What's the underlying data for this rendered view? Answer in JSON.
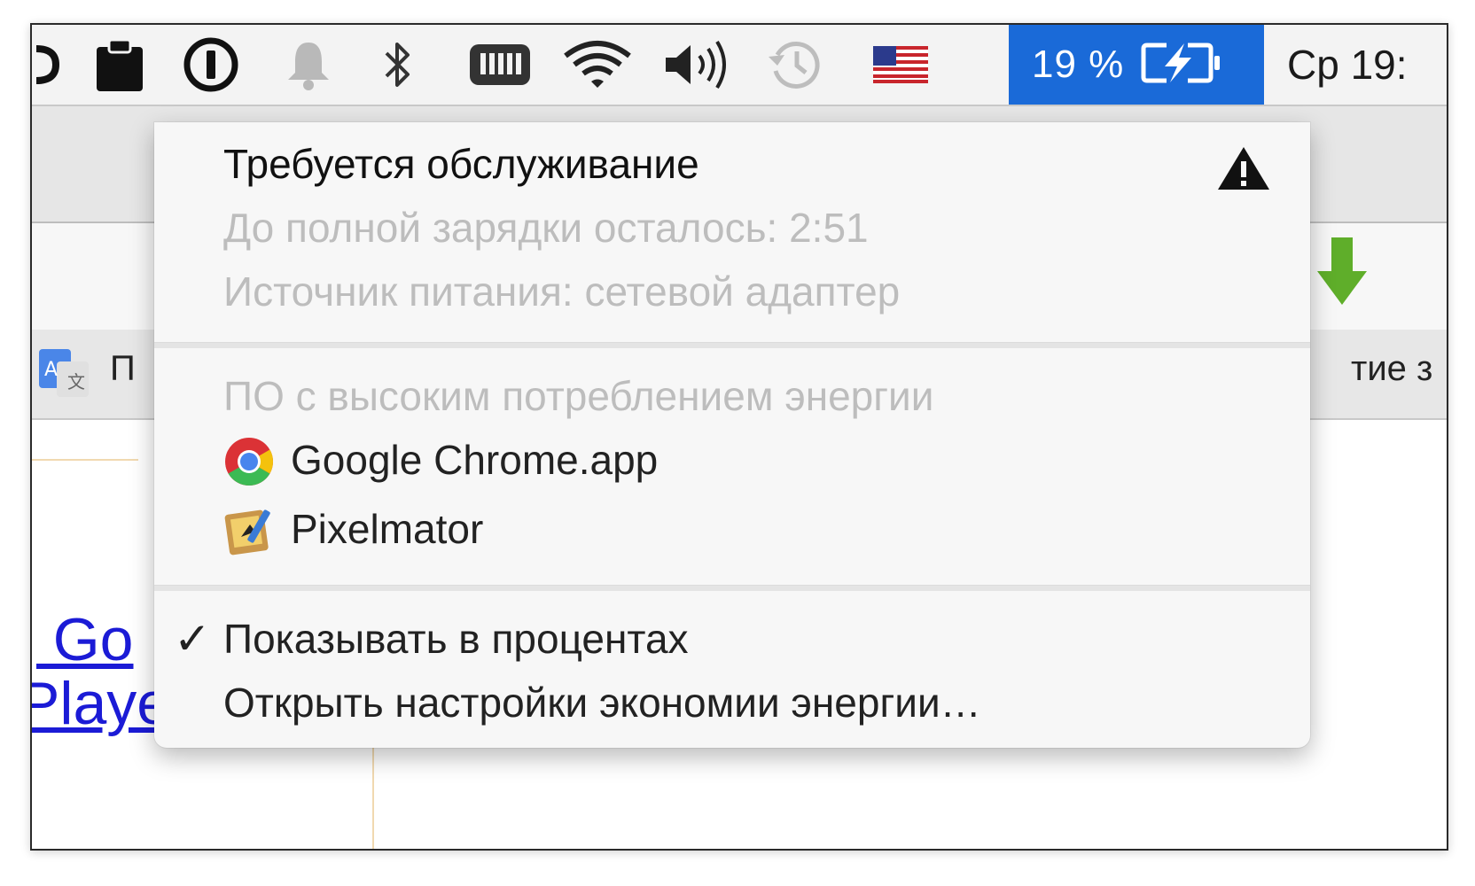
{
  "menubar": {
    "icons": [
      "app-icon-partial",
      "clipboard-icon",
      "1password-icon",
      "notification-bell-icon",
      "bluetooth-icon",
      "memory-icon",
      "wifi-icon",
      "volume-icon",
      "time-machine-icon",
      "us-flag-icon"
    ],
    "battery_percent": "19 %",
    "clock": "Ср 19:"
  },
  "browser_background": {
    "bookmark_left_label": "П",
    "bookmark_right_label": "тие з",
    "link_line1": ", Go",
    "link_line2": "Player"
  },
  "battery_menu": {
    "status_title": "Требуется обслуживание",
    "time_remaining": "До полной зарядки осталось: 2:51",
    "power_source": "Источник питания: сетевой адаптер",
    "energy_section_header": "ПО с высоким потреблением энергии",
    "apps": [
      {
        "name": "Google Chrome.app",
        "icon": "chrome-icon"
      },
      {
        "name": "Pixelmator",
        "icon": "pixelmator-icon"
      }
    ],
    "show_percentage_label": "Показывать в процентах",
    "show_percentage_checked": true,
    "check_mark": "✓",
    "open_prefs_label": "Открыть настройки экономии энергии…"
  },
  "colors": {
    "highlight": "#1a6ad8",
    "menu_background": "#f7f7f7",
    "dim_text": "#bdbdbd",
    "link": "#1b1bd6"
  }
}
